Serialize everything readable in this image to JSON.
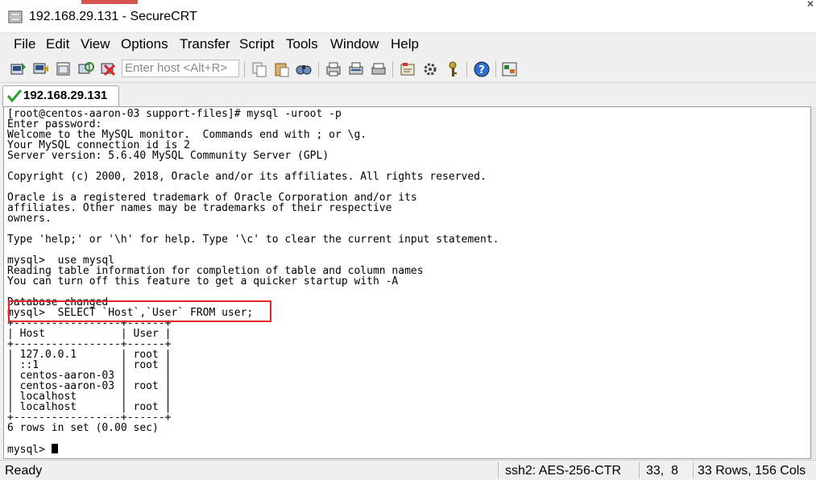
{
  "window": {
    "title": "192.168.29.131 - SecureCRT"
  },
  "menu": [
    "File",
    "Edit",
    "View",
    "Options",
    "Transfer",
    "Script",
    "Tools",
    "Window",
    "Help"
  ],
  "toolbar": {
    "host_placeholder": "Enter host <Alt+R>",
    "icons": [
      "connect-icon",
      "quick-connect-icon",
      "connect-tab-icon",
      "reconnect-icon",
      "disconnect-icon",
      "copy-icon",
      "paste-icon",
      "find-icon",
      "print-icon",
      "print-selection-icon",
      "print-screen-icon",
      "session-options-icon",
      "map-keys-icon",
      "keymap-icon",
      "help-icon",
      "sftp-icon"
    ]
  },
  "tabs": [
    {
      "label": "192.168.29.131",
      "active": true
    }
  ],
  "terminal": {
    "lines": [
      "[root@centos-aaron-03 support-files]# mysql -uroot -p",
      "Enter password:",
      "Welcome to the MySQL monitor.  Commands end with ; or \\g.",
      "Your MySQL connection id is 2",
      "Server version: 5.6.40 MySQL Community Server (GPL)",
      "",
      "Copyright (c) 2000, 2018, Oracle and/or its affiliates. All rights reserved.",
      "",
      "Oracle is a registered trademark of Oracle Corporation and/or its",
      "affiliates. Other names may be trademarks of their respective",
      "owners.",
      "",
      "Type 'help;' or '\\h' for help. Type '\\c' to clear the current input statement.",
      "",
      "mysql>  use mysql",
      "Reading table information for completion of table and column names",
      "You can turn off this feature to get a quicker startup with -A",
      "",
      "Database changed",
      "mysql>  SELECT `Host`,`User` FROM user;",
      "+-----------------+------+",
      "| Host            | User |",
      "+-----------------+------+",
      "| 127.0.0.1       | root |",
      "| ::1             | root |",
      "| centos-aaron-03 |      |",
      "| centos-aaron-03 | root |",
      "| localhost       |      |",
      "| localhost       | root |",
      "+-----------------+------+",
      "6 rows in set (0.00 sec)",
      ""
    ],
    "prompt": "mysql> "
  },
  "status": {
    "state": "Ready",
    "cipher": "ssh2: AES-256-CTR",
    "cursor_pos": "33,  8",
    "size": "33 Rows, 156 Cols"
  },
  "colors": {
    "highlight_border": "#e02828",
    "terminal_bg": "#ffffff",
    "chrome_bg": "#f0f0f0"
  }
}
